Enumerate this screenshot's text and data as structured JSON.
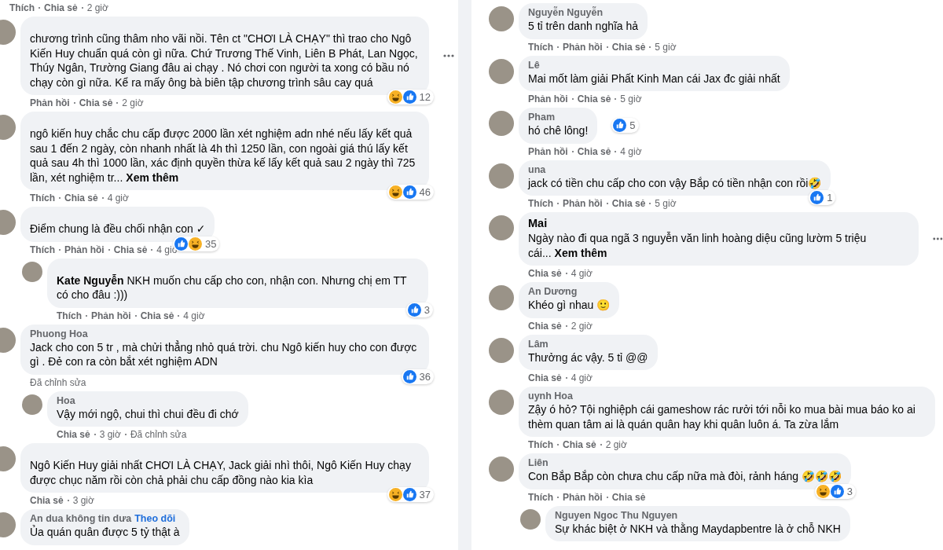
{
  "columns": [
    {
      "leading": {
        "actions": [
          "Thích",
          "Chia sẻ"
        ],
        "time": "2 giờ"
      },
      "comments": [
        {
          "text": "chương trình cũng thâm nho vãi nồi. Tên ct \"CHƠI LÀ CHẠY\" thì trao cho Ngô Kiến Huy chuẩn quá còn gì nữa. Chứ Trương Thế Vinh, Liên B Phát, Lan Ngọc, Thúy Ngân, Trường Giang đâu ai chạy . Nó chơi con người ta xong có bầu nó chạy còn gì nữa. Kể ra mấy ông bà biên tập chương trình sâu cay quá",
          "reactions": {
            "icons": [
              {
                "kind": "haha"
              },
              {
                "kind": "like"
              }
            ],
            "count": "12"
          },
          "menu": true,
          "actions": [
            "Phản hồi",
            "Chia sẻ"
          ],
          "time": "2 giờ"
        },
        {
          "text": "ngô kiến huy chắc chu cấp được 2000 lần xét nghiệm adn nhé nếu lấy kết quả sau 1 đến 2 ngày, còn nhanh nhất là 4h thì 1250 lần, con ngoài giá thú lấy kết quả sau 4h thì 1000 lần, xác định quyền thừa kế lấy kết quả sau 2 ngày thì 725 lần, xét nghiệm tr...",
          "see_more": "Xem thêm",
          "reactions": {
            "icons": [
              {
                "kind": "haha"
              },
              {
                "kind": "like"
              }
            ],
            "count": "46"
          },
          "actions": [
            "Thích",
            "Chia sẻ"
          ],
          "time": "4 giờ"
        },
        {
          "text": "Điểm chung là đều chối nhận con ✓",
          "reactions": {
            "icons": [
              {
                "kind": "like"
              },
              {
                "kind": "haha"
              }
            ],
            "count": "35"
          },
          "actions": [
            "Thích",
            "Phản hồi",
            "Chia sẻ"
          ],
          "time": "4 giờ",
          "replies": [
            {
              "text": "**Kate Nguyễn** NKH muốn chu cấp cho con, nhận con. Nhưng chị em TT có cho đâu :)))",
              "reactions": {
                "icons": [
                  {
                    "kind": "like"
                  }
                ],
                "count": "3"
              },
              "actions": [
                "Thích",
                "Phản hồi",
                "Chia sẻ"
              ],
              "time": "4 giờ"
            }
          ]
        },
        {
          "name": "Phuong Hoa",
          "text": "Jack cho con 5 tr , mà chửi thẳng nhỏ quá trời. chu Ngô kiến huy cho con được gì . Đẻ con ra còn bắt xét nghiệm ADN",
          "reactions": {
            "icons": [
              {
                "kind": "like"
              }
            ],
            "count": "36"
          },
          "edited": "Đã chỉnh sửa",
          "replies": [
            {
              "name": "Hoa",
              "text": "Vậy mới ngộ, chui thì chui đều đi chớ",
              "actions": [
                "Chia sẻ"
              ],
              "time": "3 giờ",
              "edited": "Đã chỉnh sửa"
            }
          ]
        },
        {
          "text": "Ngô Kiến Huy giải nhất CHƠI LÀ CHẠY, Jack giải nhì thôi, Ngô Kiến Huy chạy được chục năm rồi còn chả phải chu cấp đồng nào kia kìa",
          "reactions": {
            "icons": [
              {
                "kind": "haha"
              },
              {
                "kind": "like"
              }
            ],
            "count": "37"
          },
          "actions": [
            "Chia sẻ"
          ],
          "time": "3 giờ"
        },
        {
          "name": "An dua không tin dưa",
          "follow": "Theo dõi",
          "text": "Ủa quán quân được 5 tỷ thật à"
        }
      ]
    },
    {
      "comments": [
        {
          "name": "Nguyễn Nguyễn",
          "text": "5 tỉ trên danh nghĩa hả",
          "actions": [
            "Thích",
            "Phản hồi",
            "Chia sẻ"
          ],
          "time": "5 giờ"
        },
        {
          "name": "Lê",
          "text": "Mai mốt làm giải Phất Kinh Man cái Jax đc giải nhất",
          "actions": [
            "Phản hồi",
            "Chia sẻ"
          ],
          "time": "5 giờ"
        },
        {
          "name": "Pham",
          "text": "hó chê lông!",
          "reactions": {
            "icons": [
              {
                "kind": "like"
              }
            ],
            "count": "5"
          },
          "inline_reactions": true,
          "actions": [
            "Phản hồi",
            "Chia sẻ"
          ],
          "time": "4 giờ"
        },
        {
          "name": "una",
          "text": "jack có tiền chu cấp cho con vậy Bắp có tiền nhận con rồi🤣",
          "reactions": {
            "icons": [
              {
                "kind": "like"
              }
            ],
            "count": "1"
          },
          "actions": [
            "Thích",
            "Phản hồi",
            "Chia sẻ"
          ],
          "time": "5 giờ"
        },
        {
          "tag": "Mai",
          "text": "Ngày nào đi qua ngã 3 nguyễn văn linh hoàng diệu cũng lườm 5 triệu cái...",
          "see_more": "Xem thêm",
          "menu": true,
          "actions": [
            "Chia sẻ"
          ],
          "time": "4 giờ"
        },
        {
          "name": "An Dương",
          "text": "Khéo gì nhau 🙂",
          "actions": [
            "Chia sẻ"
          ],
          "time": "2 giờ"
        },
        {
          "name": "Lâm",
          "text": "Thưởng ác vậy. 5 tỉ @@",
          "actions": [
            "Chia sẻ"
          ],
          "time": "4 giờ"
        },
        {
          "name": "uynh Hoa",
          "text": "Zậy ó hỏ? Tội nghiệph cái gameshow rác rưởi tới nỗi ko mua bài mua báo ko ai thèm quan tâm ai là quán quân hay khi quân luôn á. Ta zừa lắm",
          "actions": [
            "Thích",
            "Chia sẻ"
          ],
          "time": "2 giờ"
        },
        {
          "name": "Liên",
          "text": "Con Bắp Bắp còn chưa chu cấp nữa mà đòi, rảnh háng 🤣🤣🤣",
          "reactions": {
            "icons": [
              {
                "kind": "haha"
              },
              {
                "kind": "like"
              }
            ],
            "count": "3"
          },
          "actions": [
            "Thích",
            "Phản hồi",
            "Chia sẻ"
          ],
          "replies": [
            {
              "name": "Nguyen Ngoc Thu Nguyen",
              "text": "Sự khác biệt ở NKH và thằng Maydapbentre là ở chỗ NKH"
            }
          ]
        }
      ]
    }
  ]
}
